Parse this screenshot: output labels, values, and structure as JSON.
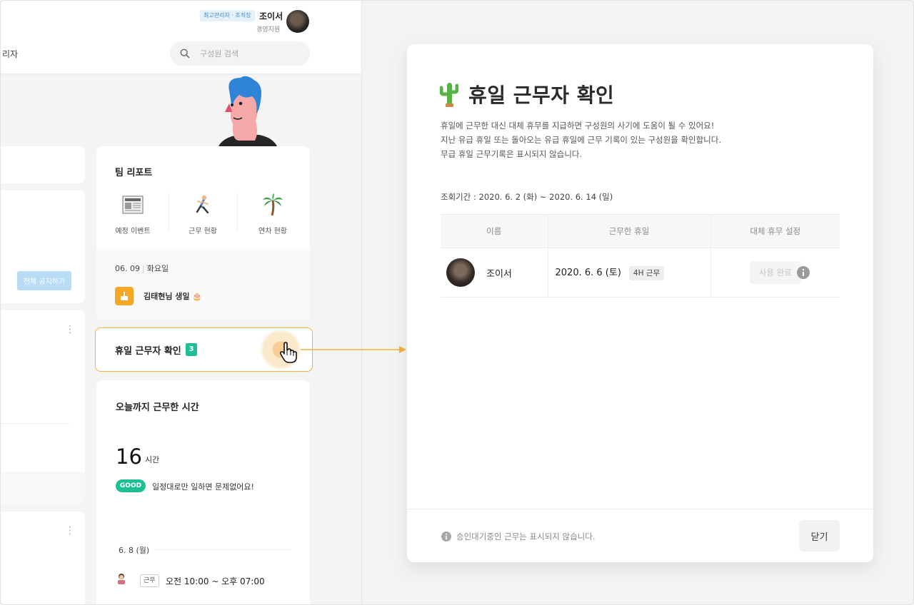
{
  "header": {
    "role_badge": "최고관리자 · 조직장",
    "user_name": "조이서",
    "user_dept": "경영지원",
    "nav_partial": "리자",
    "search_placeholder": "구성원 검색"
  },
  "left_cards": {
    "notice_button": "전체 공지하기"
  },
  "team_report": {
    "title": "팀 리포트",
    "items": [
      {
        "label": "예정 이벤트",
        "icon": "newspaper-icon"
      },
      {
        "label": "근무 현황",
        "icon": "runner-icon"
      },
      {
        "label": "연차 현황",
        "icon": "palm-tree-icon"
      }
    ],
    "event_date": "06. 09",
    "event_weekday": "화요일",
    "event_text": "김태현님 생일 🎂"
  },
  "holiday_widget": {
    "label": "휴일 근무자 확인",
    "count": "3"
  },
  "hours_widget": {
    "title": "오늘까지 근무한 시간",
    "hours": "16",
    "unit": "시간",
    "status_badge": "GOOD",
    "status_message": "일정대로만 일하면 문제없어요!",
    "day_label": "6. 8 (월)",
    "shift_badge": "근무",
    "shift_time": "오전 10:00 ~ 오후 07:00"
  },
  "modal": {
    "title": "휴일 근무자 확인",
    "description": [
      "휴일에 근무한 대신 대체 휴무를 지급하면 구성원의 사기에 도움이 될 수 있어요!",
      "지난 유급 휴일 또는 돌아오는 유급 휴일에 근무 기록이 있는 구성원을 확인합니다.",
      "무급 휴일 근무기록은 표시되지 않습니다."
    ],
    "period": "조회기간 : 2020. 6. 2 (화) ~ 2020. 6. 14 (일)",
    "table": {
      "headers": [
        "이름",
        "근무한 휴일",
        "대체 휴무 설정"
      ],
      "rows": [
        {
          "name": "조이서",
          "holiday": "2020. 6. 6 (토)",
          "hours_chip": "4H 근무",
          "action": "사용 완료"
        }
      ]
    },
    "footer_note": "승인대기중인 근무는 표시되지 않습니다.",
    "close_button": "닫기"
  },
  "colors": {
    "accent_orange": "#f2b13a",
    "accent_green": "#1fbf95",
    "badge_blue": "#3b8fd1"
  }
}
